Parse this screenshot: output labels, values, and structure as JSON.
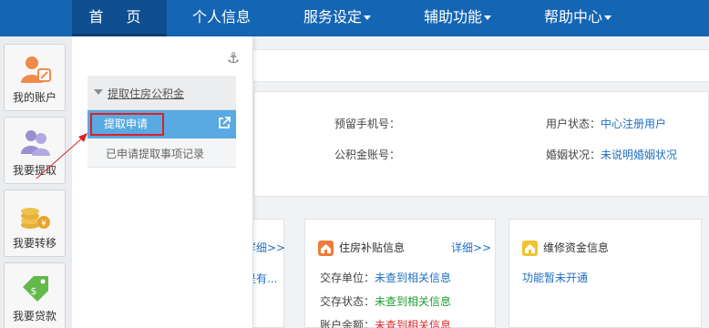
{
  "nav": {
    "items": [
      {
        "label": "首  页"
      },
      {
        "label": "个人信息"
      },
      {
        "label": "服务设定"
      },
      {
        "label": "辅助功能"
      },
      {
        "label": "帮助中心"
      }
    ]
  },
  "sidebar": {
    "items": [
      {
        "label": "我的账户",
        "icon": "account-icon"
      },
      {
        "label": "我要提取",
        "icon": "withdraw-icon"
      },
      {
        "label": "我要转移",
        "icon": "transfer-icon"
      },
      {
        "label": "我要贷款",
        "icon": "loan-icon"
      }
    ]
  },
  "dropdown": {
    "group_label": "提取住房公积金",
    "active_item": "提取申请",
    "second_item": "已申请提取事项记录"
  },
  "profile": {
    "phone_label": "预留手机号：",
    "phone_value": "",
    "user_status_label": "用户状态：",
    "user_status_value": "中心注册用户",
    "account_label": "公积金账号：",
    "account_value": "",
    "marital_label": "婚姻状况：",
    "marital_value": "未说明婚姻状况"
  },
  "boxes": {
    "left_more": "详细>>",
    "left_text": "是有...",
    "housing": {
      "title": "住房补贴信息",
      "more": "详细>>",
      "rows": [
        {
          "label": "交存单位：",
          "value": "未查到相关信息",
          "color": "#1d6fc0"
        },
        {
          "label": "交存状态：",
          "value": "未查到相关信息",
          "color": "#1c9e31"
        },
        {
          "label": "账户余额：",
          "value": "未查到相关信息",
          "color": "#e02a2a"
        }
      ]
    },
    "maintenance": {
      "title": "维修资金信息",
      "status": "功能暂未开通"
    }
  },
  "colors": {
    "nav_bg": "#1565b5",
    "nav_active": "#0f4f8f",
    "menu_active": "#59a9e2",
    "highlight_border": "#e02020"
  }
}
